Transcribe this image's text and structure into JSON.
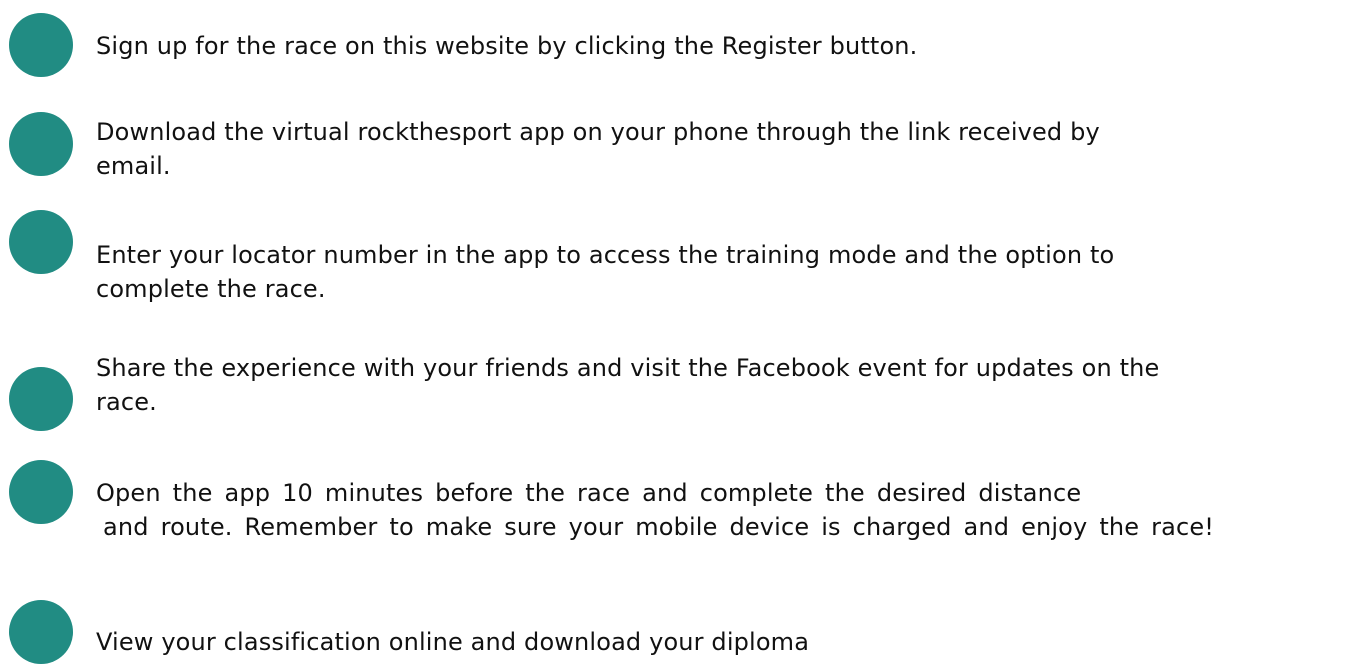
{
  "colors": {
    "bullet": "#218c83",
    "text": "#111111",
    "background": "#ffffff"
  },
  "steps": [
    {
      "icon": "bullet-circle-icon",
      "lines": [
        "Sign up for the race on this website by clicking the Register button."
      ]
    },
    {
      "icon": "bullet-circle-icon",
      "lines": [
        "Download the virtual rockthesport app on your phone through the link received by",
        "email."
      ]
    },
    {
      "icon": "bullet-circle-icon",
      "lines": [
        "Enter your locator number in the app to access the training mode and the option to",
        "complete the race."
      ]
    },
    {
      "icon": "bullet-circle-icon",
      "lines": [
        "Share the experience with your friends and visit the Facebook event for updates on the",
        "race."
      ]
    },
    {
      "icon": "bullet-circle-icon",
      "lines": [
        "Open the app 10 minutes before the race and complete the desired distance",
        "and route. Remember to make sure your mobile device is charged and enjoy the race!"
      ]
    },
    {
      "icon": "bullet-circle-icon",
      "lines": [
        "View your classification online and download your diploma"
      ]
    }
  ]
}
